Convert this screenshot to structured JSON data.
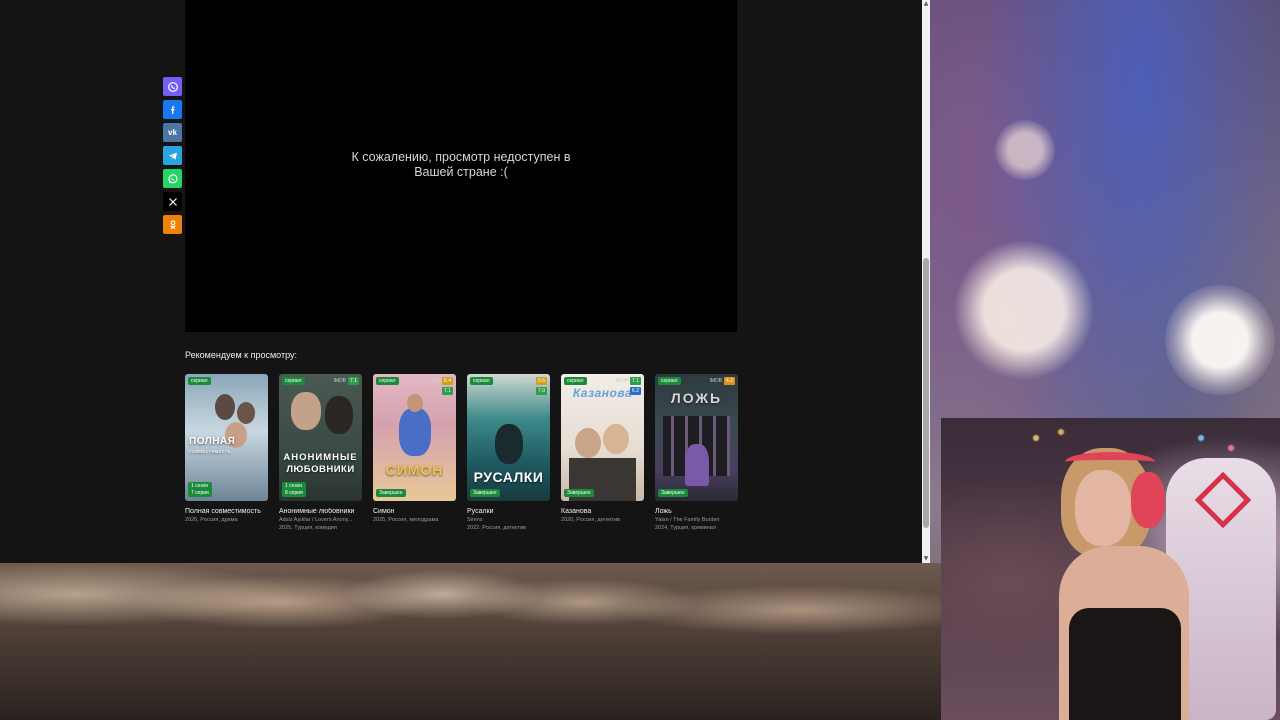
{
  "player": {
    "message": "К сожалению, просмотр недоступен в Вашей стране :("
  },
  "share_buttons": [
    {
      "name": "viber",
      "color": "#7360f2"
    },
    {
      "name": "facebook",
      "color": "#1877f2"
    },
    {
      "name": "vk",
      "color": "#4c75a3"
    },
    {
      "name": "telegram",
      "color": "#2aa3df"
    },
    {
      "name": "whatsapp",
      "color": "#25d366"
    },
    {
      "name": "x",
      "color": "#000000"
    },
    {
      "name": "odnoklassniki",
      "color": "#ee8208"
    }
  ],
  "recommend": {
    "title": "Рекомендуем к просмотру:",
    "items": [
      {
        "name": "Полная совместимость",
        "sub1": "2026, Россия, драма",
        "sub2": "",
        "type": "сериал",
        "imdb_label": "",
        "imdb": "",
        "kp": "",
        "status_line1": "1 сезон",
        "status_line2": "7 серия",
        "poster_text": "ПОЛНАЯ",
        "poster_text2": "совместимость"
      },
      {
        "name": "Анонимные любовники",
        "sub1": "Adsiz Aşıklar / Lovers Anony...",
        "sub2": "2025, Турция, комедия",
        "type": "сериал",
        "imdb_label": "IMDB",
        "imdb": "7.1",
        "kp": "",
        "status_line1": "1 сезон",
        "status_line2": "8 серия",
        "poster_text": "АНОНИМНЫЕ",
        "poster_text2": "ЛЮБОВНИКИ"
      },
      {
        "name": "Симон",
        "sub1": "2025, Россия, мелодрама",
        "sub2": "",
        "type": "сериал",
        "imdb_label": "IMDB",
        "imdb": "6.4",
        "kp": "7.1",
        "status_line1": "Завершен",
        "status_line2": "",
        "poster_text": "СИМОН",
        "poster_text2": ""
      },
      {
        "name": "Русалки",
        "sub1": "Sirens",
        "sub2": "2022, Россия, детектив",
        "type": "сериал",
        "imdb_label": "IMDB",
        "imdb": "5.5",
        "kp": "7.0",
        "status_line1": "Завершен",
        "status_line2": "",
        "poster_text": "РУСАЛКИ",
        "poster_text2": ""
      },
      {
        "name": "Казанова",
        "sub1": "2020, Россия, детектив",
        "sub2": "",
        "type": "сериал",
        "imdb_label": "IMDB",
        "imdb": "7.1",
        "kp": "6.2",
        "status_line1": "Завершен",
        "status_line2": "",
        "poster_text": "Казанова",
        "poster_text2": ""
      },
      {
        "name": "Ложь",
        "sub1": "Yalan / The Family Burden",
        "sub2": "2024, Турция, криминал",
        "type": "сериал",
        "imdb_label": "IMDB",
        "imdb": "4.2",
        "kp": "",
        "status_line1": "Завершен",
        "status_line2": "",
        "poster_text": "ЛОЖЬ",
        "poster_text2": ""
      }
    ]
  }
}
